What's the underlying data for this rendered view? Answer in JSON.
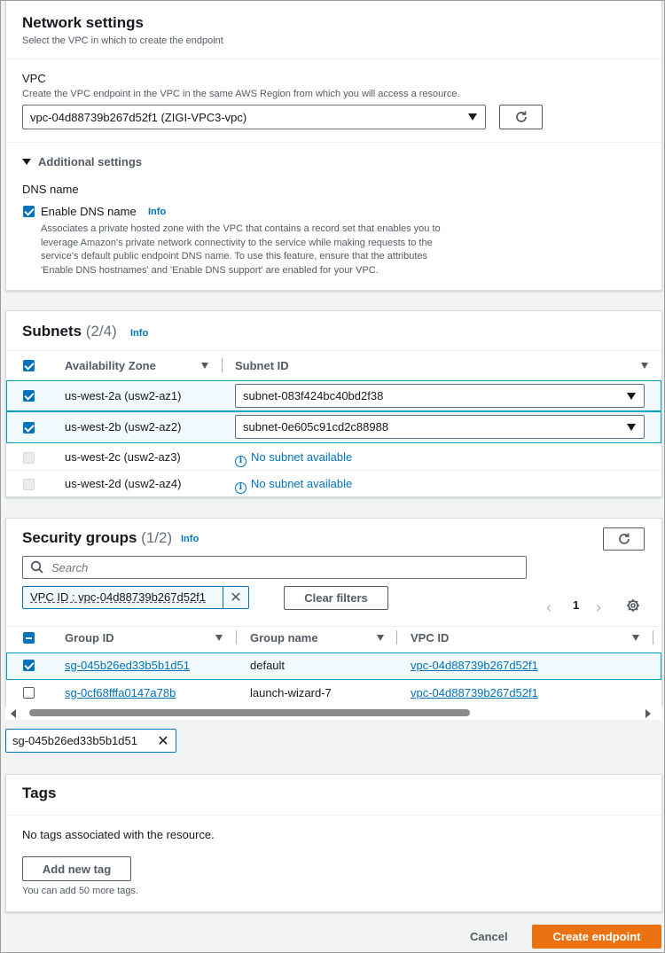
{
  "network": {
    "title": "Network settings",
    "description": "Select the VPC in which to create the endpoint",
    "vpc_label": "VPC",
    "vpc_description": "Create the VPC endpoint in the VPC in the same AWS Region from which you will access a resource.",
    "vpc_value": "vpc-04d88739b267d52f1 (ZIGI-VPC3-vpc)",
    "additional_settings": "Additional settings",
    "dns_heading": "DNS name",
    "enable_dns_label": "Enable DNS name",
    "info": "Info",
    "dns_help_lines": [
      "Associates a private hosted zone with the VPC that contains a record set that enables you to",
      "leverage Amazon's private network connectivity to the service while making requests to the",
      "service's default public endpoint DNS name. To use this feature, ensure that the attributes",
      "'Enable DNS hostnames' and 'Enable DNS support' are enabled for your VPC."
    ]
  },
  "subnets": {
    "title": "Subnets",
    "count": "(2/4)",
    "info": "Info",
    "columns": [
      "Availability Zone",
      "Subnet ID"
    ],
    "rows": [
      {
        "az": "us-west-2a (usw2-az1)",
        "subnet": "subnet-083f424bc40bd2f38"
      },
      {
        "az": "us-west-2b (usw2-az2)",
        "subnet": "subnet-0e605c91cd2c88988"
      },
      {
        "az": "us-west-2c (usw2-az3)",
        "subnet": "No subnet available"
      },
      {
        "az": "us-west-2d (usw2-az4)",
        "subnet": "No subnet available"
      }
    ]
  },
  "security": {
    "title": "Security groups",
    "count": "(1/2)",
    "info": "Info",
    "search_placeholder": "Search",
    "filter_token": "VPC ID : vpc-04d88739b267d52f1",
    "clear_filters": "Clear filters",
    "page": "1",
    "columns": [
      "Group ID",
      "Group name",
      "VPC ID"
    ],
    "rows": [
      {
        "id": "sg-045b26ed33b5b1d51",
        "name": "default",
        "vpc": "vpc-04d88739b267d52f1"
      },
      {
        "id": "sg-0cf68fffa0147a78b",
        "name": "launch-wizard-7",
        "vpc": "vpc-04d88739b267d52f1"
      }
    ],
    "selected_token": "sg-045b26ed33b5b1d51"
  },
  "tags": {
    "title": "Tags",
    "empty": "No tags associated with the resource.",
    "add_button": "Add new tag",
    "limit": "You can add 50 more tags."
  },
  "footer": {
    "cancel": "Cancel",
    "create": "Create endpoint"
  },
  "colors": {
    "accent": "#0073bb",
    "primary_button": "#ec7211"
  }
}
